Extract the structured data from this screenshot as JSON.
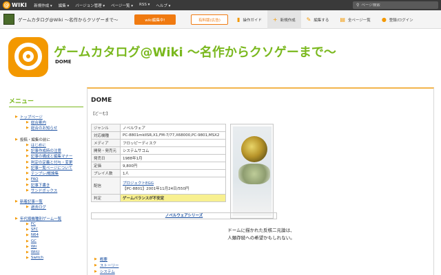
{
  "topbar": {
    "logo_text": "WIKI",
    "menu": [
      "新規作成 ▾",
      "編集 ▾",
      "バージョン管理 ▾",
      "ページ一覧 ▾",
      "RSS ▾",
      "ヘルプ ▾"
    ],
    "search_placeholder": "ページ検索"
  },
  "secondbar": {
    "site_title": "ゲームカタログ@Wiki ～名作からクソゲーまで～",
    "edit_button": "wiki編集中!",
    "ad_button": "有料版(広告)",
    "tools": [
      {
        "label": "操作ガイド",
        "icon": "book-icon"
      },
      {
        "label": "新規作成",
        "icon": "plus-icon"
      },
      {
        "label": "編集する",
        "icon": "pencil-icon"
      },
      {
        "label": "全ページ一覧",
        "icon": "document-icon"
      },
      {
        "label": "登録/ログイン",
        "icon": "user-icon"
      }
    ]
  },
  "header": {
    "title": "ゲームカタログ@Wiki ～名作からクソゲーまで～",
    "subtitle": "DOME"
  },
  "sidebar": {
    "title": "メニュー",
    "sections": [
      {
        "label": "トップページ",
        "link": true,
        "items": [
          "総合案内",
          "総合のお知らせ"
        ]
      },
      {
        "label": "投稿・編集の前に",
        "link": false,
        "items": [
          "はじめに",
          "記事作成時の注意",
          "記事の構成と編集マナー",
          "判定の定義と付与・変更",
          "記事一覧ページについて",
          "テンプレ/概論集",
          "FAQ",
          "記事下書き",
          "サンドボックス"
        ]
      },
      {
        "label": "新着記事一覧",
        "link": true,
        "items": [
          "過去ログ"
        ]
      },
      {
        "label": "年代順機種別ゲーム一覧",
        "link": true,
        "items": [
          "FC",
          "SFC",
          "N64",
          "GC",
          "Wii",
          "WiiU",
          "Switch"
        ]
      }
    ]
  },
  "main": {
    "heading": "DOME",
    "bracket": "【どーむ】",
    "info_rows": [
      {
        "key": "ジャンル",
        "value": "ノベルウェア"
      },
      {
        "key": "対応機種",
        "value": "PC-8801mkIISR,X1,FM-7/77,X68000,PC-9801,MSX2"
      },
      {
        "key": "メディア",
        "value": "フロッピーディスク"
      },
      {
        "key": "開発・発売元",
        "value": "システムサコム"
      },
      {
        "key": "発売日",
        "value": "1988年1月"
      },
      {
        "key": "定価",
        "value": "9,800円"
      },
      {
        "key": "プレイ人数",
        "value": "1人"
      }
    ],
    "distribution": {
      "key": "配信",
      "link": "プロジェクトEGG",
      "detail": "【PC-8801】2001年11月24日/550円"
    },
    "judgment": {
      "key": "判定",
      "value": "ゲームバランスが不安定"
    },
    "series": "ノベルウェアシリーズ",
    "quote_lines": [
      "ドームに描かれた反核二元論は、",
      "人類存続への希望かもしれない。"
    ],
    "toc": [
      "概要",
      "ストーリー",
      "システム"
    ]
  }
}
